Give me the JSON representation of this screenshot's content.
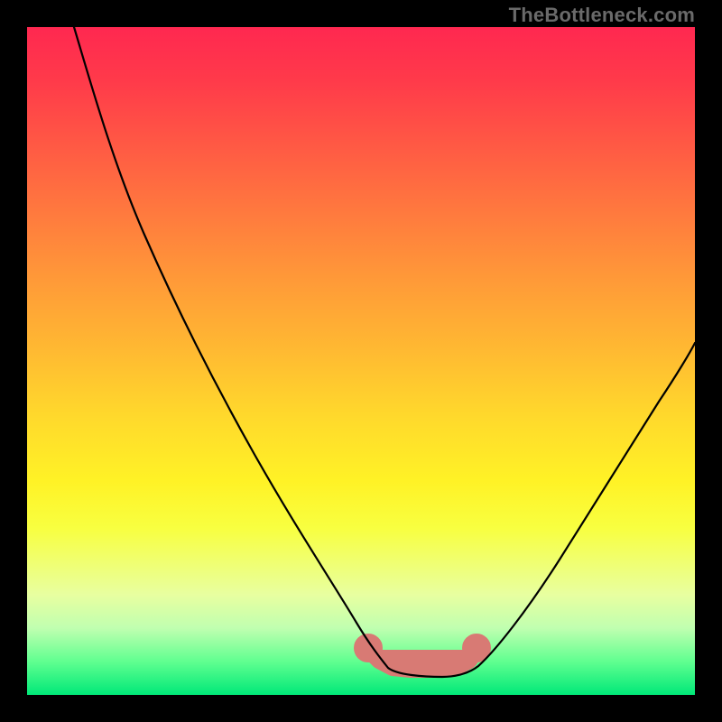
{
  "watermark": "TheBottleneck.com",
  "colors": {
    "gradient_top": "#ff2850",
    "gradient_mid": "#fff226",
    "gradient_bottom": "#00e878",
    "curve": "#000000",
    "blob": "#d87a74",
    "frame": "#000000"
  },
  "chart_data": {
    "type": "line",
    "title": "",
    "xlabel": "",
    "ylabel": "",
    "xlim": [
      0,
      100
    ],
    "ylim": [
      0,
      100
    ],
    "grid": false,
    "legend": false,
    "series": [
      {
        "name": "left-branch",
        "x": [
          7,
          12,
          18,
          24,
          30,
          36,
          42,
          47,
          50,
          52,
          54
        ],
        "y": [
          100,
          88,
          74,
          60,
          46,
          33,
          21,
          12,
          7,
          5,
          4
        ]
      },
      {
        "name": "right-branch",
        "x": [
          66,
          70,
          75,
          80,
          86,
          92,
          98,
          100
        ],
        "y": [
          4,
          6,
          11,
          18,
          28,
          40,
          52,
          58
        ]
      },
      {
        "name": "bottom-flat",
        "x": [
          54,
          58,
          62,
          66
        ],
        "y": [
          4,
          3.5,
          3.5,
          4
        ]
      }
    ],
    "highlight_region": {
      "name": "salmon-blob",
      "x_range": [
        50,
        68
      ],
      "y": 4
    }
  }
}
